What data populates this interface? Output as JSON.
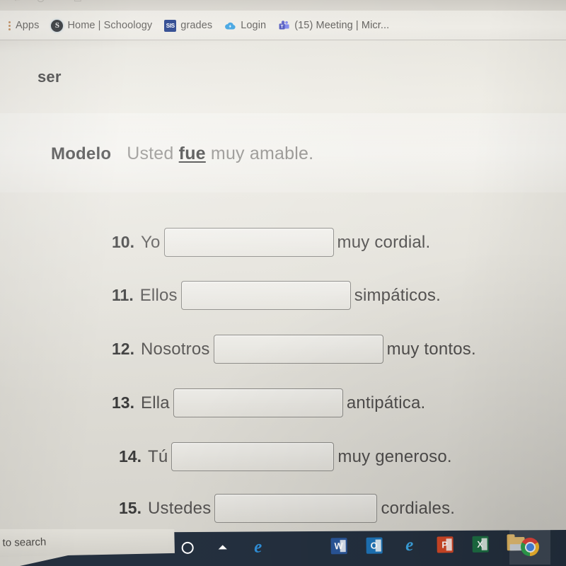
{
  "browser": {
    "bookmarks_bar": {
      "apps_label": "Apps",
      "apps_icon": "apps-grid-dots-icon",
      "items": [
        {
          "label": "Home | Schoology",
          "icon": "schoology-icon",
          "glyph": "S"
        },
        {
          "label": "grades",
          "icon": "sis-icon",
          "glyph": "SIS"
        },
        {
          "label": "Login",
          "icon": "cloud-icon",
          "glyph": "☁"
        },
        {
          "label": "(15) Meeting | Micr...",
          "icon": "microsoft-teams-icon",
          "glyph": "❖"
        }
      ]
    }
  },
  "worksheet": {
    "verb_heading": "ser",
    "modelo": {
      "label": "Modelo",
      "prefix": "Usted ",
      "answer": "fue",
      "suffix": " muy amable."
    },
    "items": [
      {
        "number": "10.",
        "subject": "Yo",
        "rest": "muy cordial.",
        "blank_width": 240,
        "blank_value": "",
        "blank_placeholder": ""
      },
      {
        "number": "11.",
        "subject": "Ellos",
        "rest": "simpáticos.",
        "blank_width": 240,
        "blank_value": "",
        "blank_placeholder": ""
      },
      {
        "number": "12.",
        "subject": "Nosotros",
        "rest": "muy tontos.",
        "blank_width": 240,
        "blank_value": "",
        "blank_placeholder": ""
      },
      {
        "number": "13.",
        "subject": "Ella",
        "rest": "antipática.",
        "blank_width": 240,
        "blank_value": "",
        "blank_placeholder": ""
      },
      {
        "number": "14.",
        "subject": "Tú",
        "rest": "muy generoso.",
        "blank_width": 230,
        "blank_value": "",
        "blank_placeholder": ""
      },
      {
        "number": "15.",
        "subject": "Ustedes",
        "rest": "cordiales.",
        "blank_width": 230,
        "blank_value": "",
        "blank_placeholder": ""
      }
    ]
  },
  "taskbar": {
    "search_text": "to search",
    "icons": [
      {
        "name": "cortana-icon",
        "label": "Cortana"
      },
      {
        "name": "task-view-icon",
        "label": "Task View"
      },
      {
        "name": "microsoft-edge-icon",
        "label": "Microsoft Edge"
      },
      {
        "name": "word-icon",
        "label": "Word"
      },
      {
        "name": "outlook-icon",
        "label": "Outlook"
      },
      {
        "name": "internet-explorer-icon",
        "label": "Internet Explorer"
      },
      {
        "name": "powerpoint-icon",
        "label": "PowerPoint"
      },
      {
        "name": "excel-icon",
        "label": "Excel"
      },
      {
        "name": "file-explorer-icon",
        "label": "File Explorer"
      },
      {
        "name": "chrome-icon",
        "label": "Google Chrome"
      }
    ],
    "glyphs": {
      "task_view": "⏶",
      "edge": "e",
      "ie": "e",
      "word": "W",
      "outlook": "O",
      "ppt": "P",
      "excel": "X"
    }
  },
  "colors": {
    "taskbar_bg": "#24303f",
    "page_bg": "#e9e7e0",
    "text": "#4f4d4c",
    "heading": "#3a3a3a",
    "blank_border": "#8b8a86",
    "schoology": "#2b2f33",
    "sis": "#1f3c88",
    "teams": "#5b5fc7",
    "chrome_blue": "#4a8cf0"
  }
}
